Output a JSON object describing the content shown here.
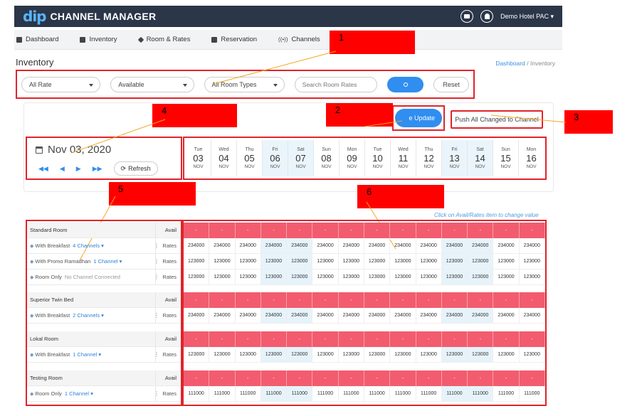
{
  "app": {
    "logo": "dip",
    "title": "CHANNEL MANAGER",
    "user": "Demo Hotel PAC ▾"
  },
  "nav": [
    {
      "label": "Dashboard",
      "icon": "grid-icon"
    },
    {
      "label": "Inventory",
      "icon": "calendar-icon"
    },
    {
      "label": "Room & Rates",
      "icon": "tag-icon"
    },
    {
      "label": "Reservation",
      "icon": "clipboard-icon"
    },
    {
      "label": "Channels",
      "icon": "signal-icon"
    }
  ],
  "page": {
    "title": "Inventory",
    "breadcrumb_link": "Dashboard",
    "breadcrumb_sep": "/",
    "breadcrumb_current": "Inventory"
  },
  "filters": {
    "rate": "All Rate",
    "availability": "Available",
    "room_types": "All Room Types",
    "search_placeholder": "Search Room Rates",
    "reset": "Reset"
  },
  "actions": {
    "update": "e Update",
    "push": "Push All Changed to Channel"
  },
  "date": {
    "current": "Nov 03, 2020",
    "refresh": "Refresh"
  },
  "days": [
    {
      "dn": "Tue",
      "dd": "03",
      "dm": "NOV",
      "weekend": false
    },
    {
      "dn": "Wed",
      "dd": "04",
      "dm": "NOV",
      "weekend": false
    },
    {
      "dn": "Thu",
      "dd": "05",
      "dm": "NOV",
      "weekend": false
    },
    {
      "dn": "Fri",
      "dd": "06",
      "dm": "NOV",
      "weekend": true
    },
    {
      "dn": "Sat",
      "dd": "07",
      "dm": "NOV",
      "weekend": true
    },
    {
      "dn": "Sun",
      "dd": "08",
      "dm": "NOV",
      "weekend": false
    },
    {
      "dn": "Mon",
      "dd": "09",
      "dm": "NOV",
      "weekend": false
    },
    {
      "dn": "Tue",
      "dd": "10",
      "dm": "NOV",
      "weekend": false
    },
    {
      "dn": "Wed",
      "dd": "11",
      "dm": "NOV",
      "weekend": false
    },
    {
      "dn": "Thu",
      "dd": "12",
      "dm": "NOV",
      "weekend": false
    },
    {
      "dn": "Fri",
      "dd": "13",
      "dm": "NOV",
      "weekend": true
    },
    {
      "dn": "Sat",
      "dd": "14",
      "dm": "NOV",
      "weekend": true
    },
    {
      "dn": "Sun",
      "dd": "15",
      "dm": "NOV",
      "weekend": false
    },
    {
      "dn": "Mon",
      "dd": "16",
      "dm": "NOV",
      "weekend": false
    }
  ],
  "hint": "Click on Avail/Rates item to change value",
  "avail_value": "-",
  "rows": [
    {
      "type": "room",
      "name": "Standard Room",
      "kind": "Avail"
    },
    {
      "type": "rate",
      "name": "With Breakfast",
      "channel": "4 Channels ▾",
      "kind": "Rates",
      "value": "234000"
    },
    {
      "type": "rate",
      "name": "With Promo Ramadhan",
      "channel": "1 Channel ▾",
      "kind": "Rates",
      "value": "123000"
    },
    {
      "type": "rate",
      "name": "Room Only",
      "nochannel": "No Channel Connected",
      "kind": "Rates",
      "value": "123000"
    },
    {
      "type": "room",
      "name": "Superior Twin Bed",
      "kind": "Avail"
    },
    {
      "type": "rate",
      "name": "With Breakfast",
      "channel": "2 Channels ▾",
      "kind": "Rates",
      "value": "234000"
    },
    {
      "type": "room",
      "name": "Lokal Room",
      "kind": "Avail"
    },
    {
      "type": "rate",
      "name": "With Breakfast",
      "channel": "1 Channel ▾",
      "kind": "Rates",
      "value": "123000"
    },
    {
      "type": "room",
      "name": "Testing Room",
      "kind": "Avail"
    },
    {
      "type": "rate",
      "name": "Room Only",
      "channel": "1 Channel ▾",
      "kind": "Rates",
      "value": "111000"
    }
  ],
  "callouts": [
    "1",
    "2",
    "3",
    "4",
    "5",
    "6"
  ]
}
